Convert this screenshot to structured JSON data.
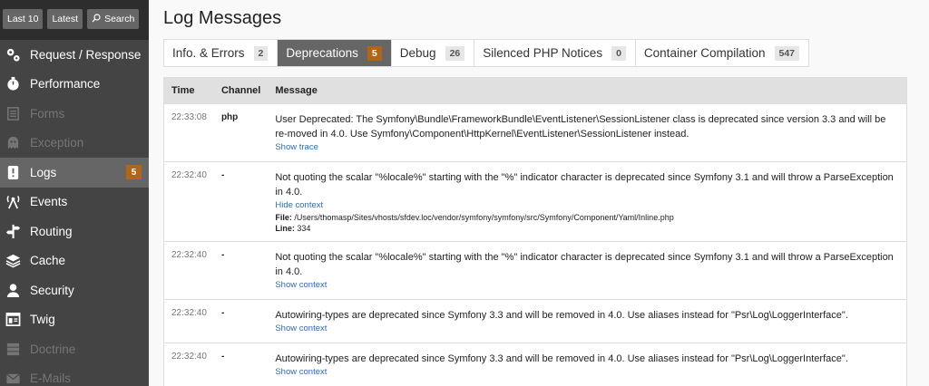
{
  "toolbar": {
    "last10_label": "Last 10",
    "latest_label": "Latest",
    "search_label": "Search"
  },
  "sidebar": {
    "items": [
      {
        "label": "Request / Response",
        "icon": "gears-icon",
        "disabled": false
      },
      {
        "label": "Performance",
        "icon": "stopwatch-icon",
        "disabled": false
      },
      {
        "label": "Forms",
        "icon": "form-icon",
        "disabled": true
      },
      {
        "label": "Exception",
        "icon": "ghost-icon",
        "disabled": true
      },
      {
        "label": "Logs",
        "icon": "alert-icon",
        "disabled": false,
        "count": "5"
      },
      {
        "label": "Events",
        "icon": "antenna-icon",
        "disabled": false
      },
      {
        "label": "Routing",
        "icon": "signpost-icon",
        "disabled": false
      },
      {
        "label": "Cache",
        "icon": "layers-icon",
        "disabled": false
      },
      {
        "label": "Security",
        "icon": "user-icon",
        "disabled": false
      },
      {
        "label": "Twig",
        "icon": "template-icon",
        "disabled": false
      },
      {
        "label": "Doctrine",
        "icon": "database-icon",
        "disabled": true
      },
      {
        "label": "E-Mails",
        "icon": "envelope-icon",
        "disabled": true
      }
    ]
  },
  "page_title": "Log Messages",
  "tabs": [
    {
      "label": "Info. & Errors",
      "count": "2"
    },
    {
      "label": "Deprecations",
      "count": "5"
    },
    {
      "label": "Debug",
      "count": "26"
    },
    {
      "label": "Silenced PHP Notices",
      "count": "0"
    },
    {
      "label": "Container Compilation",
      "count": "547"
    }
  ],
  "table": {
    "headers": {
      "time": "Time",
      "channel": "Channel",
      "message": "Message"
    },
    "rows": [
      {
        "time": "22:33:08",
        "channel": "php",
        "message": "User Deprecated: The Symfony\\Bundle\\FrameworkBundle\\EventListener\\SessionListener class is deprecated since version 3.3 and will be re-moved in 4.0. Use Symfony\\Component\\HttpKernel\\EventListener\\SessionListener instead.",
        "link": "Show trace"
      },
      {
        "time": "22:32:40",
        "channel": "-",
        "message": "Not quoting the scalar \"%locale%\" starting with the \"%\" indicator character is deprecated since Symfony 3.1 and will throw a ParseException in 4.0.",
        "link": "Hide context",
        "file_label": "File:",
        "file_value": "/Users/thomasp/Sites/vhosts/sfdev.loc/vendor/symfony/symfony/src/Symfony/Component/Yaml/Inline.php",
        "line_label": "Line:",
        "line_value": "334"
      },
      {
        "time": "22:32:40",
        "channel": "-",
        "message": "Not quoting the scalar \"%locale%\" starting with the \"%\" indicator character is deprecated since Symfony 3.1 and will throw a ParseException in 4.0.",
        "link": "Show context"
      },
      {
        "time": "22:32:40",
        "channel": "-",
        "message": "Autowiring-types are deprecated since Symfony 3.3 and will be removed in 4.0. Use aliases instead for \"Psr\\Log\\LoggerInterface\".",
        "link": "Show context"
      },
      {
        "time": "22:32:40",
        "channel": "-",
        "message": "Autowiring-types are deprecated since Symfony 3.3 and will be removed in 4.0. Use aliases instead for \"Psr\\Log\\LoggerInterface\".",
        "link": "Show context"
      }
    ]
  },
  "colors": {
    "accent": "#b0651a",
    "sidebar_bg": "#444444",
    "link": "#2f6ea8"
  }
}
